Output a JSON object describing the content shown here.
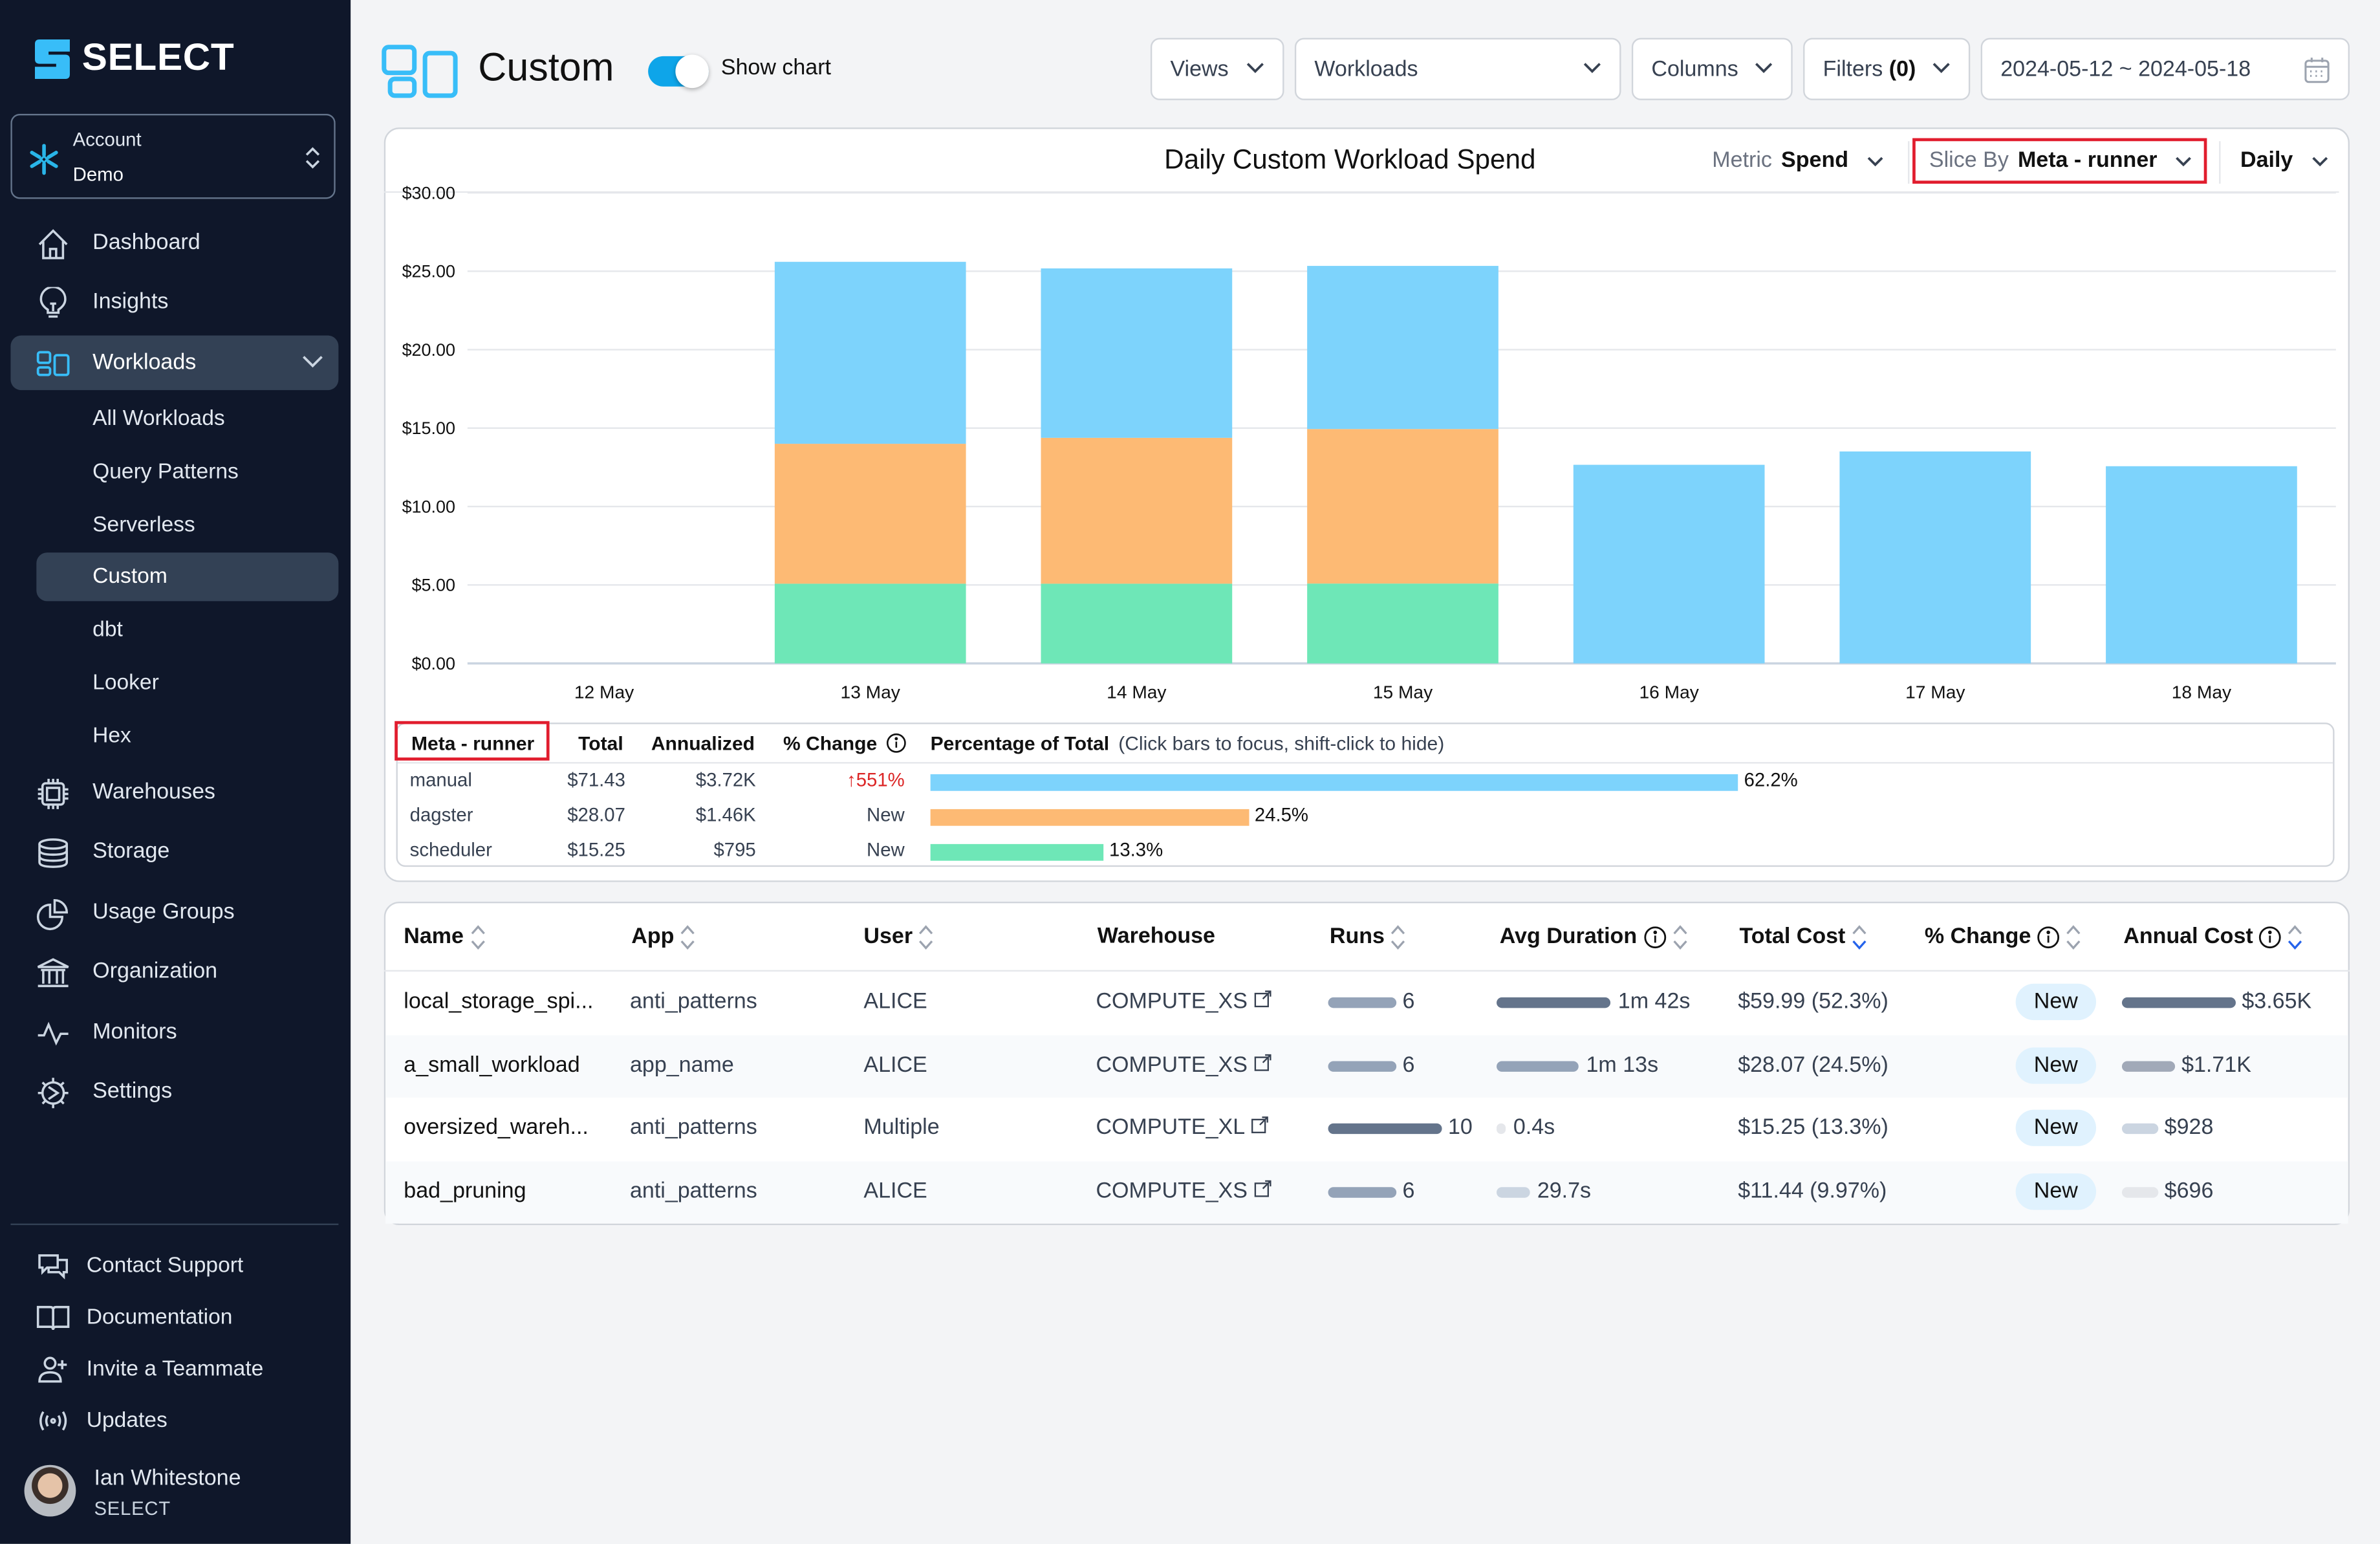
{
  "app": {
    "brand": "SELECT"
  },
  "account": {
    "label": "Account",
    "value": "Demo"
  },
  "sidebar": {
    "items": [
      {
        "label": "Dashboard",
        "icon": "home-icon"
      },
      {
        "label": "Insights",
        "icon": "lightbulb-icon"
      },
      {
        "label": "Workloads",
        "icon": "workloads-icon",
        "active": true,
        "expanded": true
      },
      {
        "label": "Warehouses",
        "icon": "chip-icon"
      },
      {
        "label": "Storage",
        "icon": "database-icon"
      },
      {
        "label": "Usage Groups",
        "icon": "pie-chart-icon"
      },
      {
        "label": "Organization",
        "icon": "bank-icon"
      },
      {
        "label": "Monitors",
        "icon": "activity-icon"
      },
      {
        "label": "Settings",
        "icon": "gear-icon"
      }
    ],
    "sub_items": [
      {
        "label": "All Workloads"
      },
      {
        "label": "Query Patterns"
      },
      {
        "label": "Serverless"
      },
      {
        "label": "Custom",
        "active": true
      },
      {
        "label": "dbt"
      },
      {
        "label": "Looker"
      },
      {
        "label": "Hex"
      }
    ],
    "footer": [
      {
        "label": "Contact Support",
        "icon": "chat-icon"
      },
      {
        "label": "Documentation",
        "icon": "book-icon"
      },
      {
        "label": "Invite a Teammate",
        "icon": "user-plus-icon"
      },
      {
        "label": "Updates",
        "icon": "broadcast-icon"
      }
    ],
    "user": {
      "name": "Ian Whitestone",
      "org": "SELECT"
    }
  },
  "header": {
    "title": "Custom",
    "show_chart_label": "Show chart",
    "show_chart": true,
    "views_label": "Views",
    "workloads_label": "Workloads",
    "columns_label": "Columns",
    "filters_label": "Filters",
    "filters_count": "(0)",
    "date_range": "2024-05-12 ~ 2024-05-18"
  },
  "chart_controls": {
    "metric_label": "Metric",
    "metric_value": "Spend",
    "slice_label": "Slice By",
    "slice_value": "Meta - runner",
    "granularity": "Daily"
  },
  "chart_data": {
    "type": "bar",
    "stacked": true,
    "title": "Daily Custom Workload Spend",
    "xlabel": "",
    "ylabel": "",
    "categories": [
      "12 May",
      "13 May",
      "14 May",
      "15 May",
      "16 May",
      "17 May",
      "18 May"
    ],
    "ylim": [
      0,
      30
    ],
    "yticks": [
      "$0.00",
      "$5.00",
      "$10.00",
      "$15.00",
      "$20.00",
      "$25.00",
      "$30.00"
    ],
    "grid": true,
    "series": [
      {
        "name": "scheduler",
        "color": "#6ee7b7",
        "values": [
          0,
          5.08,
          5.08,
          5.09,
          0,
          0,
          0
        ]
      },
      {
        "name": "dagster",
        "color": "#fdba74",
        "values": [
          0,
          8.92,
          9.3,
          9.85,
          0,
          0,
          0
        ]
      },
      {
        "name": "manual",
        "color": "#7dd3fc",
        "values": [
          0,
          11.6,
          10.8,
          10.4,
          12.66,
          13.51,
          12.57
        ]
      }
    ]
  },
  "legend_table": {
    "headers": {
      "group": "Meta - runner",
      "total": "Total",
      "annualized": "Annualized",
      "change": "% Change",
      "pct": "Percentage of Total",
      "hint": "(Click bars to focus, shift-click to hide)"
    },
    "rows": [
      {
        "name": "manual",
        "total": "$71.43",
        "annualized": "$3.72K",
        "change": "551%",
        "change_dir": "up",
        "pct_label": "62.2%",
        "pct": 62.2,
        "color": "#7dd3fc"
      },
      {
        "name": "dagster",
        "total": "$28.07",
        "annualized": "$1.46K",
        "change": "New",
        "pct_label": "24.5%",
        "pct": 24.5,
        "color": "#fdba74"
      },
      {
        "name": "scheduler",
        "total": "$15.25",
        "annualized": "$795",
        "change": "New",
        "pct_label": "13.3%",
        "pct": 13.3,
        "color": "#6ee7b7"
      }
    ]
  },
  "table": {
    "columns": [
      "Name",
      "App",
      "User",
      "Warehouse",
      "Runs",
      "Avg Duration",
      "Total Cost",
      "% Change",
      "Annual Cost"
    ],
    "sorted_by": "Annual Cost",
    "rows": [
      {
        "name": "local_storage_spi...",
        "app": "anti_patterns",
        "user": "ALICE",
        "warehouse": "COMPUTE_XS",
        "runs": "6",
        "runs_frac": 0.6,
        "duration": "1m 42s",
        "duration_frac": 1.0,
        "total_cost": "$59.99 (52.3%)",
        "change": "New",
        "annual": "$3.65K",
        "annual_frac": 1.0
      },
      {
        "name": "a_small_workload",
        "app": "app_name",
        "user": "ALICE",
        "warehouse": "COMPUTE_XS",
        "runs": "6",
        "runs_frac": 0.6,
        "duration": "1m 13s",
        "duration_frac": 0.72,
        "total_cost": "$28.07 (24.5%)",
        "change": "New",
        "annual": "$1.71K",
        "annual_frac": 0.47
      },
      {
        "name": "oversized_wareh...",
        "app": "anti_patterns",
        "user": "Multiple",
        "warehouse": "COMPUTE_XL",
        "runs": "10",
        "runs_frac": 1.0,
        "duration": "0.4s",
        "duration_frac": 0.004,
        "total_cost": "$15.25 (13.3%)",
        "change": "New",
        "annual": "$928",
        "annual_frac": 0.25
      },
      {
        "name": "bad_pruning",
        "app": "anti_patterns",
        "user": "ALICE",
        "warehouse": "COMPUTE_XS",
        "runs": "6",
        "runs_frac": 0.6,
        "duration": "29.7s",
        "duration_frac": 0.29,
        "total_cost": "$11.44 (9.97%)",
        "change": "New",
        "annual": "$696",
        "annual_frac": 0.19
      }
    ]
  },
  "colors": {
    "accent": "#0ea5e9",
    "sidebar_bg": "#0f172a",
    "highlight": "#e11d2e"
  }
}
